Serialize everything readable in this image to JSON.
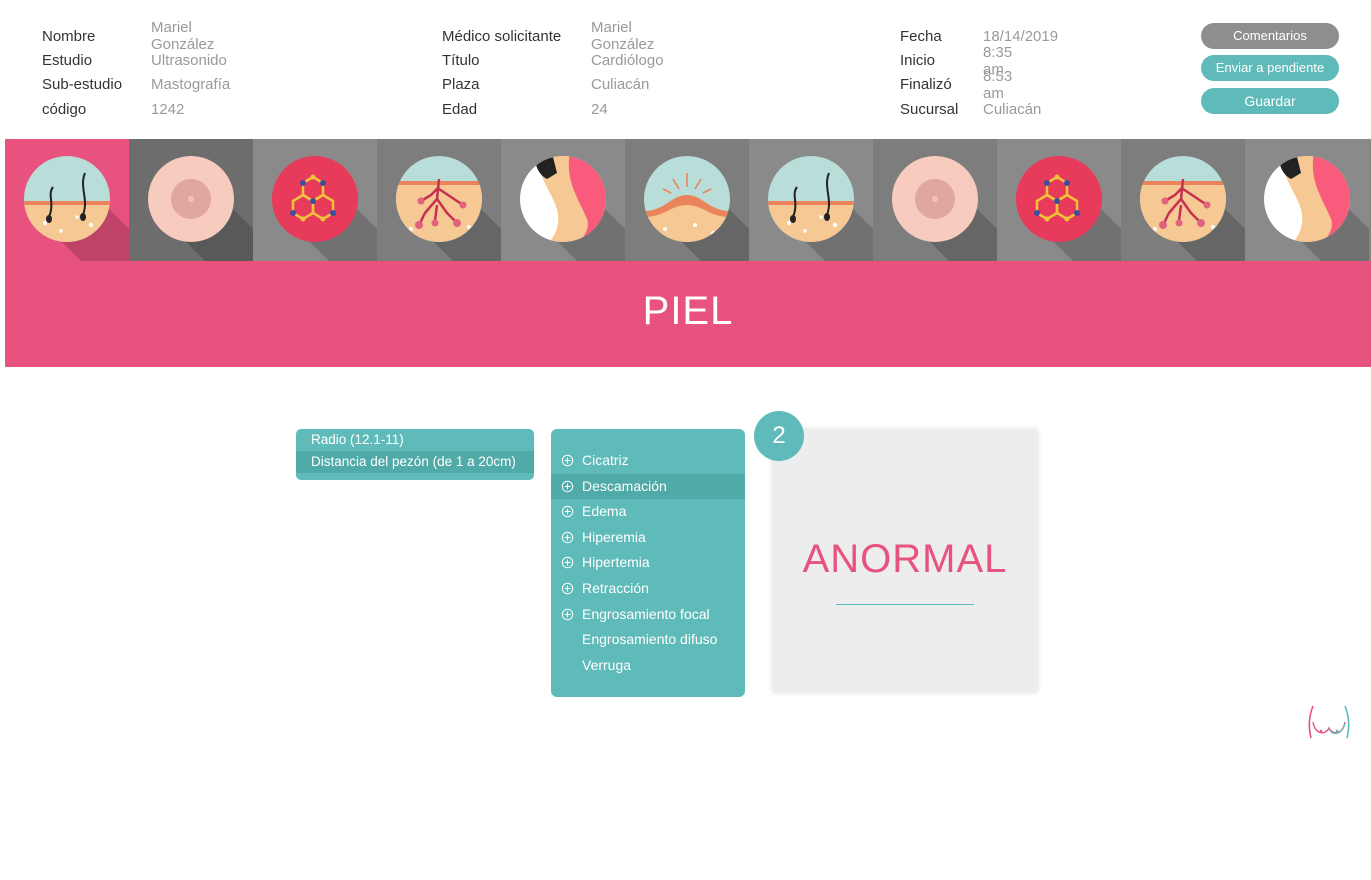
{
  "patient": {
    "rows": [
      {
        "label": "Nombre",
        "value": "Mariel González"
      },
      {
        "label": "Estudio",
        "value": "Ultrasonido"
      },
      {
        "label": "Sub-estudio",
        "value": "Mastografía"
      },
      {
        "label": "código",
        "value": "1242"
      }
    ]
  },
  "request": {
    "rows": [
      {
        "label": "Médico solicitante",
        "value": "Mariel González"
      },
      {
        "label": "Título",
        "value": "Cardiólogo"
      },
      {
        "label": "Plaza",
        "value": "Culiacán"
      },
      {
        "label": "Edad",
        "value": "24"
      }
    ]
  },
  "session": {
    "rows": [
      {
        "label": "Fecha",
        "value": "18/14/2019"
      },
      {
        "label": "Inicio",
        "value": "8:35 am"
      },
      {
        "label": "Finalizó",
        "value": "8:53 am"
      },
      {
        "label": "Sucursal",
        "value": "Culiacán"
      }
    ]
  },
  "actions": {
    "comments": "Comentarios",
    "pending": "Enviar a pendiente",
    "save": "Guardar"
  },
  "strip": {
    "icons": [
      "skin-hair-icon",
      "nipple-icon",
      "molecule-icon",
      "vessels-icon",
      "breast-profile-icon",
      "skin-swelling-icon",
      "skin-hair-icon",
      "nipple-icon",
      "molecule-icon",
      "vessels-icon",
      "breast-profile-icon"
    ],
    "active_index": 0
  },
  "banner": {
    "title": "PIEL"
  },
  "range": {
    "items": [
      "Radio (12.1-11)",
      "Distancia del pezón (de 1 a 20cm)"
    ],
    "selected_index": 1
  },
  "findings": {
    "items": [
      {
        "label": "Cicatriz",
        "expandable": true
      },
      {
        "label": "Descamación",
        "expandable": true
      },
      {
        "label": "Edema",
        "expandable": true
      },
      {
        "label": "Hiperemia",
        "expandable": true
      },
      {
        "label": "Hipertemia",
        "expandable": true
      },
      {
        "label": "Retracción",
        "expandable": true
      },
      {
        "label": "Engrosamiento focal",
        "expandable": true
      },
      {
        "label": "Engrosamiento difuso",
        "expandable": false
      },
      {
        "label": "Verruga",
        "expandable": false
      }
    ],
    "selected_index": 1,
    "count": "2"
  },
  "result": {
    "text": "ANORMAL"
  },
  "colors": {
    "accent_pink": "#e8527e",
    "accent_teal": "#5ebbb9",
    "neutral_gray": "#8e8e8e"
  }
}
